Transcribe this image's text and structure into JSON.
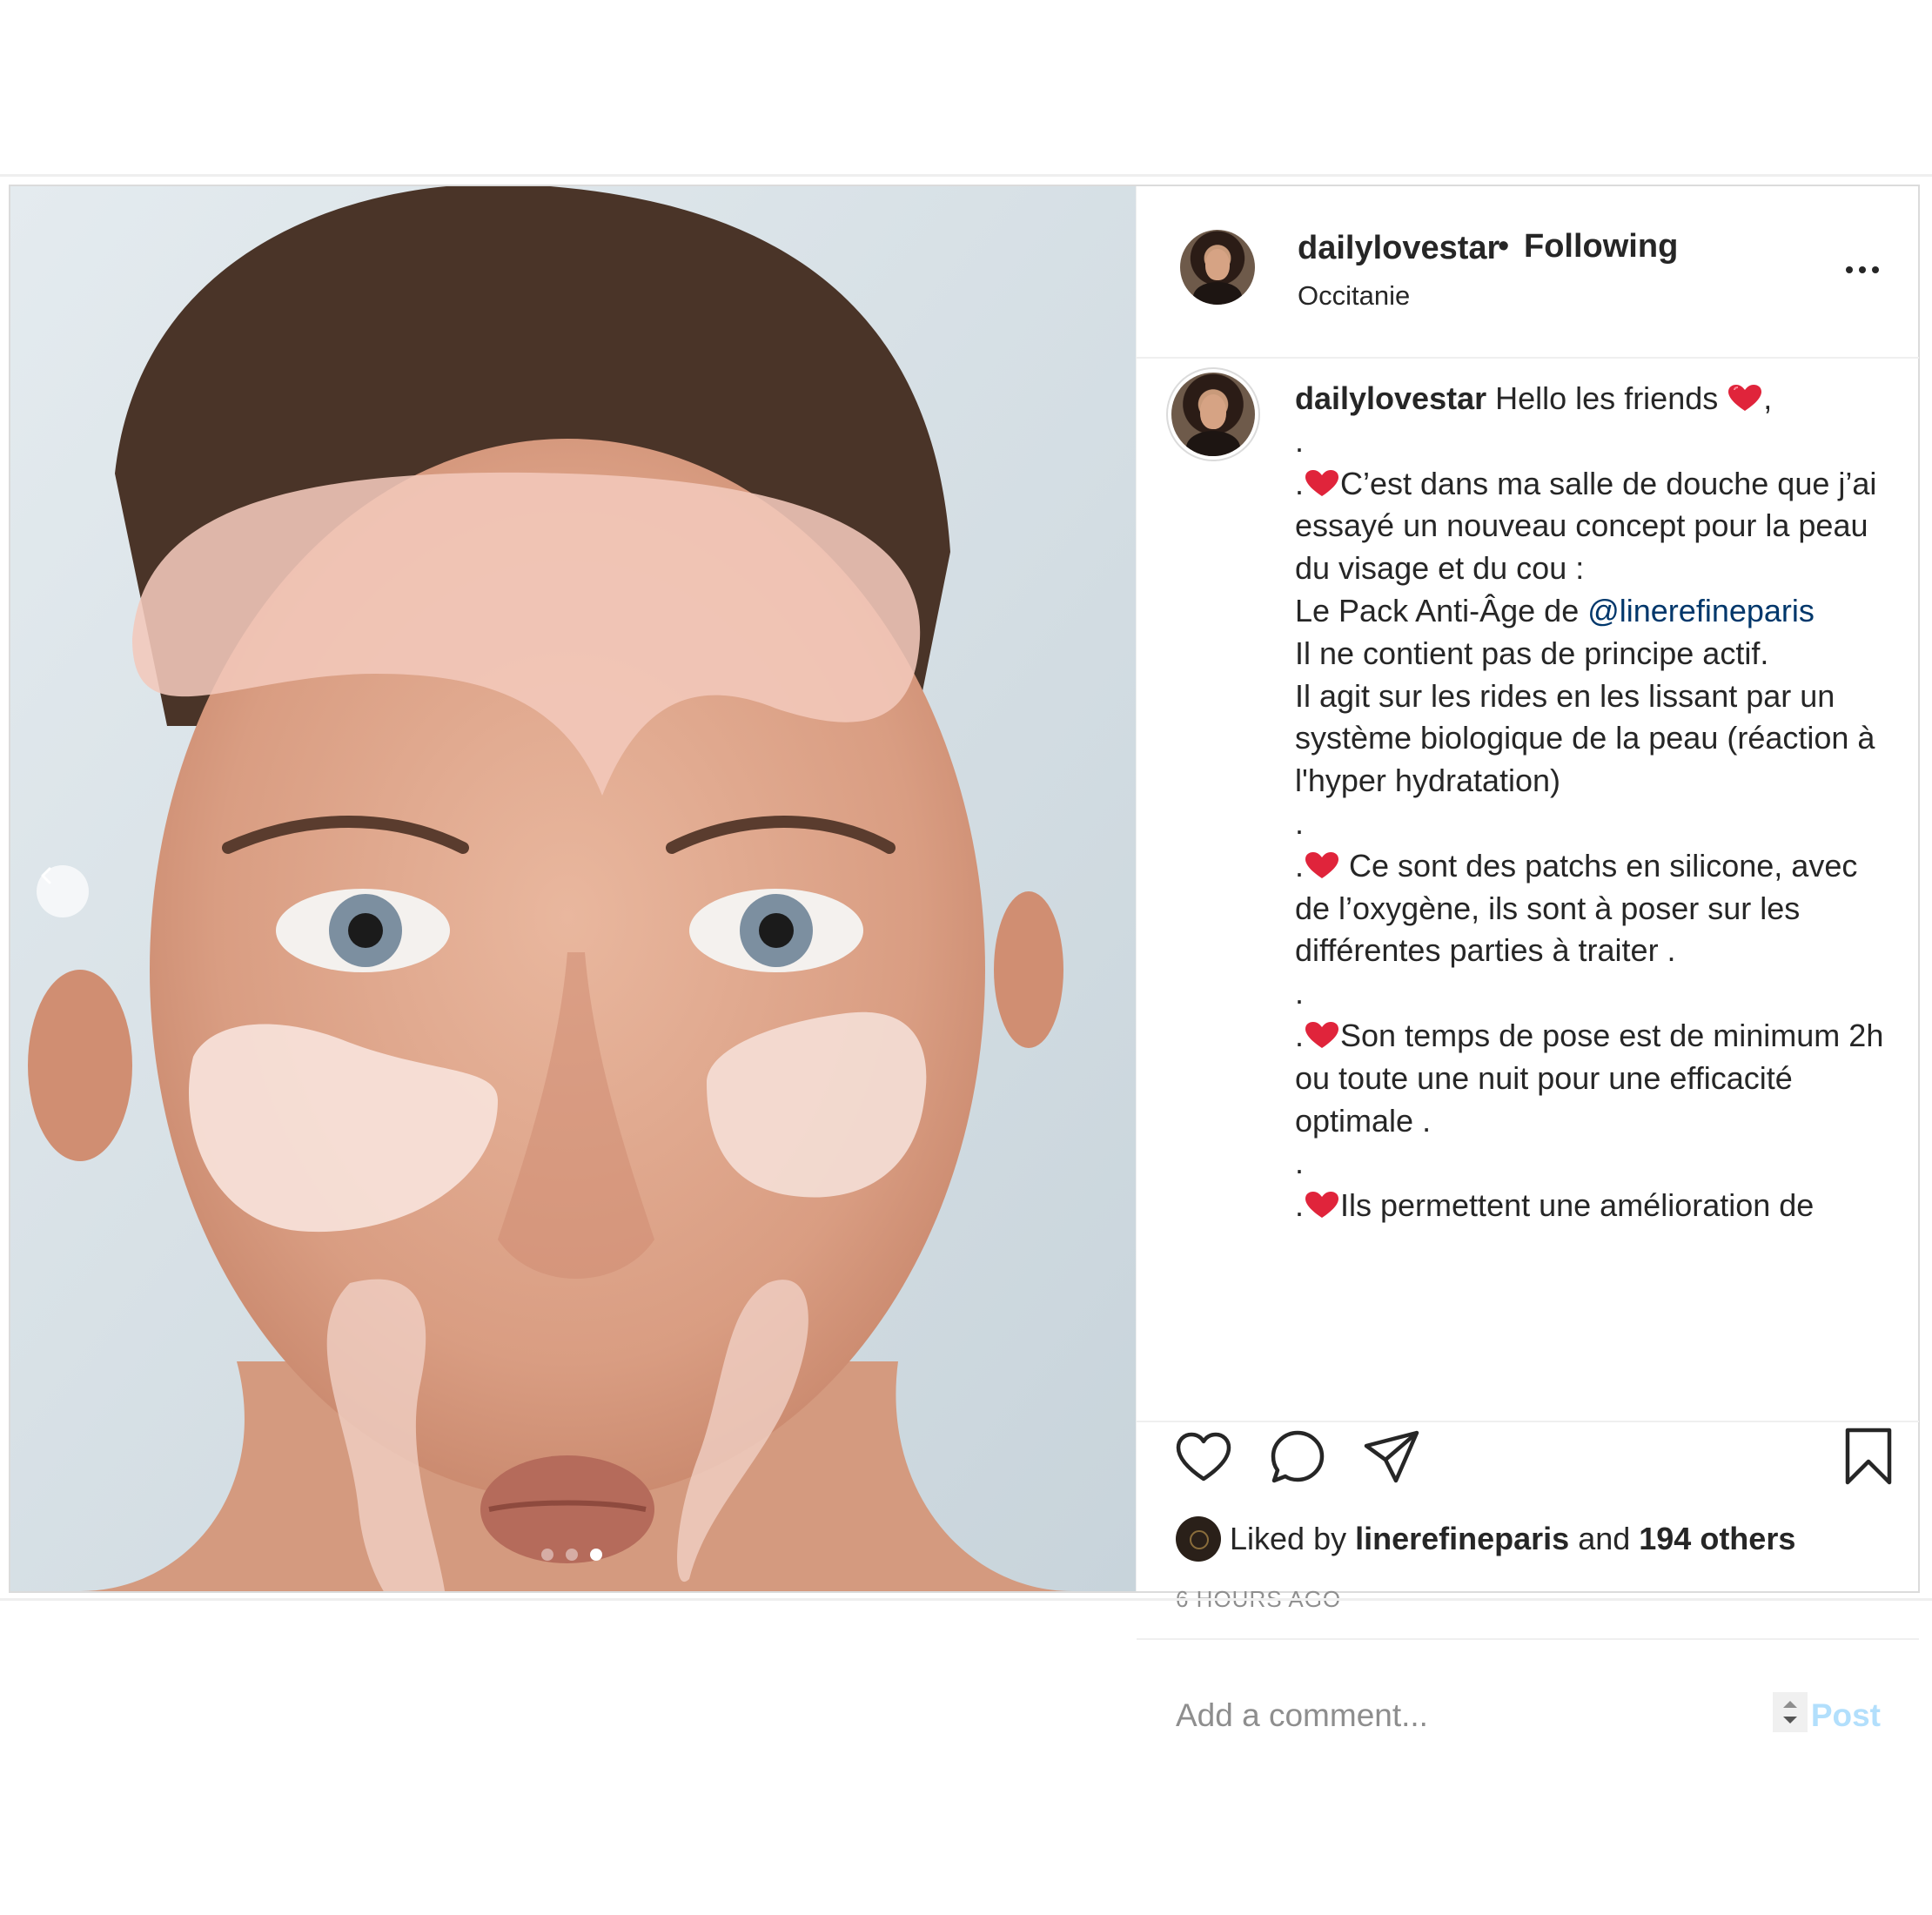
{
  "post": {
    "username": "dailylovestar",
    "separator": "•",
    "follow_status": "Following",
    "location": "Occitanie",
    "carousel": {
      "total": 3,
      "active_index": 2
    }
  },
  "caption": {
    "username": "dailylovestar",
    "line1": " Hello les friends ",
    "line1_end": ",",
    "dot": ".",
    "p1_a": "C’est dans ma salle de douche que j’ai essayé un nouveau concept pour la peau du visage et du cou :",
    "p1_b": "Le Pack Anti-Âge de ",
    "mention": "@linerefineparis",
    "p1_c": "Il ne contient pas de principe actif.",
    "p1_d": "Il agit sur les rides en les lissant par un système biologique de la peau (réaction à l'hyper hydratation)",
    "p2": " Ce sont des patchs en silicone, avec de l’oxygène, ils sont à poser sur les différentes parties à traiter .",
    "p3": "Son temps de pose est de minimum 2h ou toute une nuit pour une efficacité optimale .",
    "p4": "Ils permettent une amélioration de"
  },
  "likes": {
    "prefix": "Liked by ",
    "user": "linerefineparis",
    "middle": " and ",
    "others": "194 others"
  },
  "timestamp": "6 HOURS AGO",
  "comment": {
    "placeholder": "Add a comment...",
    "post_label": "Post"
  },
  "icons": [
    "heart-icon",
    "comment-icon",
    "share-icon",
    "bookmark-icon",
    "more-icon",
    "chevron-left-icon"
  ],
  "colors": {
    "mention": "#00376b",
    "post_disabled": "#b2dffc",
    "heart_red": "#ed4956"
  }
}
